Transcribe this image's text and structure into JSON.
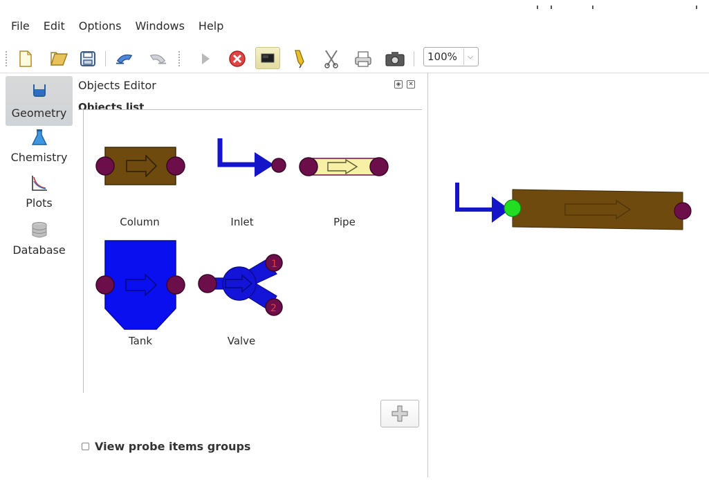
{
  "menu": [
    "File",
    "Edit",
    "Options",
    "Windows",
    "Help"
  ],
  "toolbar": {
    "icons": [
      "new-file-icon",
      "open-folder-icon",
      "save-icon",
      "undo-icon",
      "redo-icon",
      "play-icon",
      "stop-icon",
      "screen-icon",
      "pencil-icon",
      "scissors-icon",
      "print-icon",
      "camera-icon"
    ],
    "zoom": "100%"
  },
  "sidebar": {
    "items": [
      {
        "label": "Geometry",
        "icon": "beaker-icon",
        "active": true
      },
      {
        "label": "Chemistry",
        "icon": "flask-icon",
        "active": false
      },
      {
        "label": "Plots",
        "icon": "plot-icon",
        "active": false
      },
      {
        "label": "Database",
        "icon": "database-icon",
        "active": false
      }
    ]
  },
  "editor": {
    "title": "Objects Editor",
    "list_label": "Objects list",
    "objects": [
      {
        "label": "Column"
      },
      {
        "label": "Inlet"
      },
      {
        "label": "Pipe"
      },
      {
        "label": "Tank"
      },
      {
        "label": "Valve"
      }
    ],
    "valve_ports": [
      "1",
      "2"
    ],
    "probe_label": "View probe items groups"
  },
  "colors": {
    "column_brown": "#6e4a0e",
    "pipe_yellow": "#f7f0a6",
    "tank_blue": "#0a0ff0",
    "port_purple": "#6b0e4a",
    "inlet_blue": "#1414c8",
    "connected_green": "#22dd22"
  }
}
